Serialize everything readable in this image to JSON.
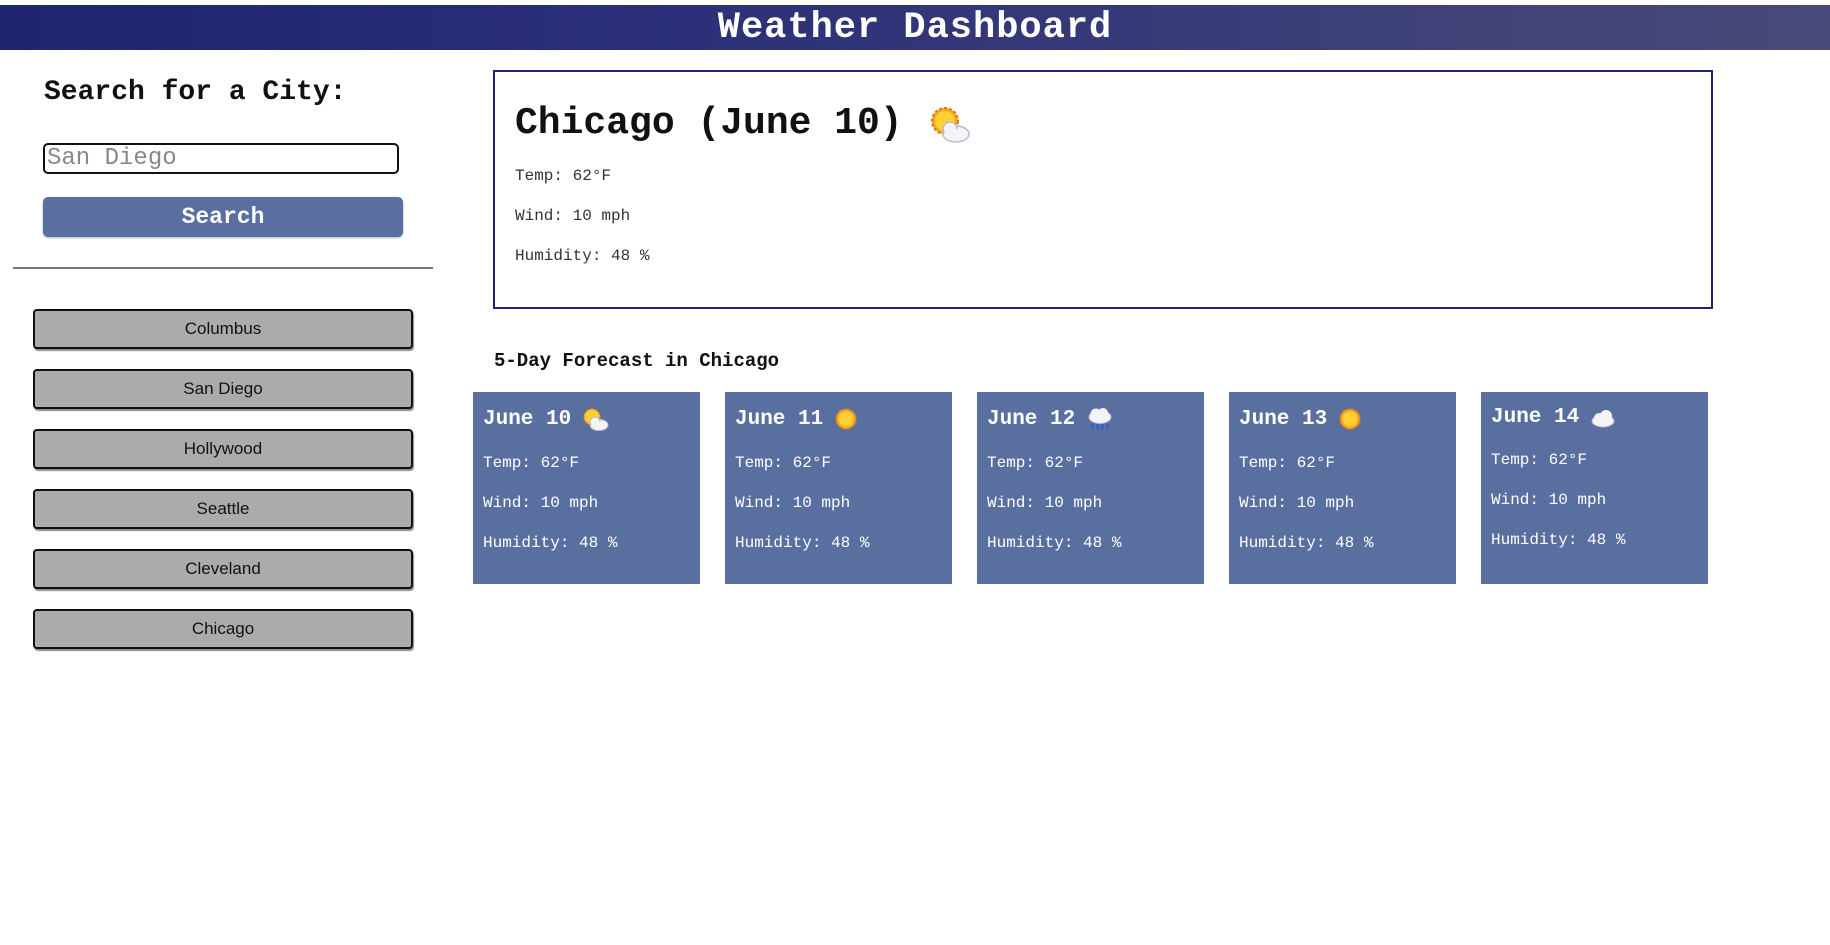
{
  "header": {
    "title": "Weather Dashboard"
  },
  "search": {
    "title": "Search for a City:",
    "placeholder": "San Diego",
    "button_label": "Search"
  },
  "history": [
    {
      "label": "Columbus"
    },
    {
      "label": "San Diego"
    },
    {
      "label": "Hollywood"
    },
    {
      "label": "Seattle"
    },
    {
      "label": "Cleveland"
    },
    {
      "label": "Chicago"
    }
  ],
  "current": {
    "title": "Chicago (June 10)",
    "icon": "partly-cloudy-icon",
    "temp": "Temp: 62°F",
    "wind": "Wind: 10 mph",
    "humidity": "Humidity: 48 %"
  },
  "forecast": {
    "heading": "5-Day Forecast in Chicago",
    "days": [
      {
        "date": "June 10",
        "icon": "partly-cloudy-icon",
        "temp": "Temp: 62°F",
        "wind": "Wind: 10 mph",
        "humidity": "Humidity: 48 %"
      },
      {
        "date": "June 11",
        "icon": "sun-icon",
        "temp": "Temp: 62°F",
        "wind": "Wind: 10 mph",
        "humidity": "Humidity: 48 %"
      },
      {
        "date": "June 12",
        "icon": "rain-cloud-icon",
        "temp": "Temp: 62°F",
        "wind": "Wind: 10 mph",
        "humidity": "Humidity: 48 %"
      },
      {
        "date": "June 13",
        "icon": "sun-icon",
        "temp": "Temp: 62°F",
        "wind": "Wind: 10 mph",
        "humidity": "Humidity: 48 %"
      },
      {
        "date": "June 14",
        "icon": "cloud-icon",
        "temp": "Temp: 62°F",
        "wind": "Wind: 10 mph",
        "humidity": "Humidity: 48 %"
      }
    ]
  },
  "colors": {
    "header_start": "#1f2470",
    "header_end": "#4a4a78",
    "accent": "#596f9f",
    "history_button": "#ababab"
  }
}
